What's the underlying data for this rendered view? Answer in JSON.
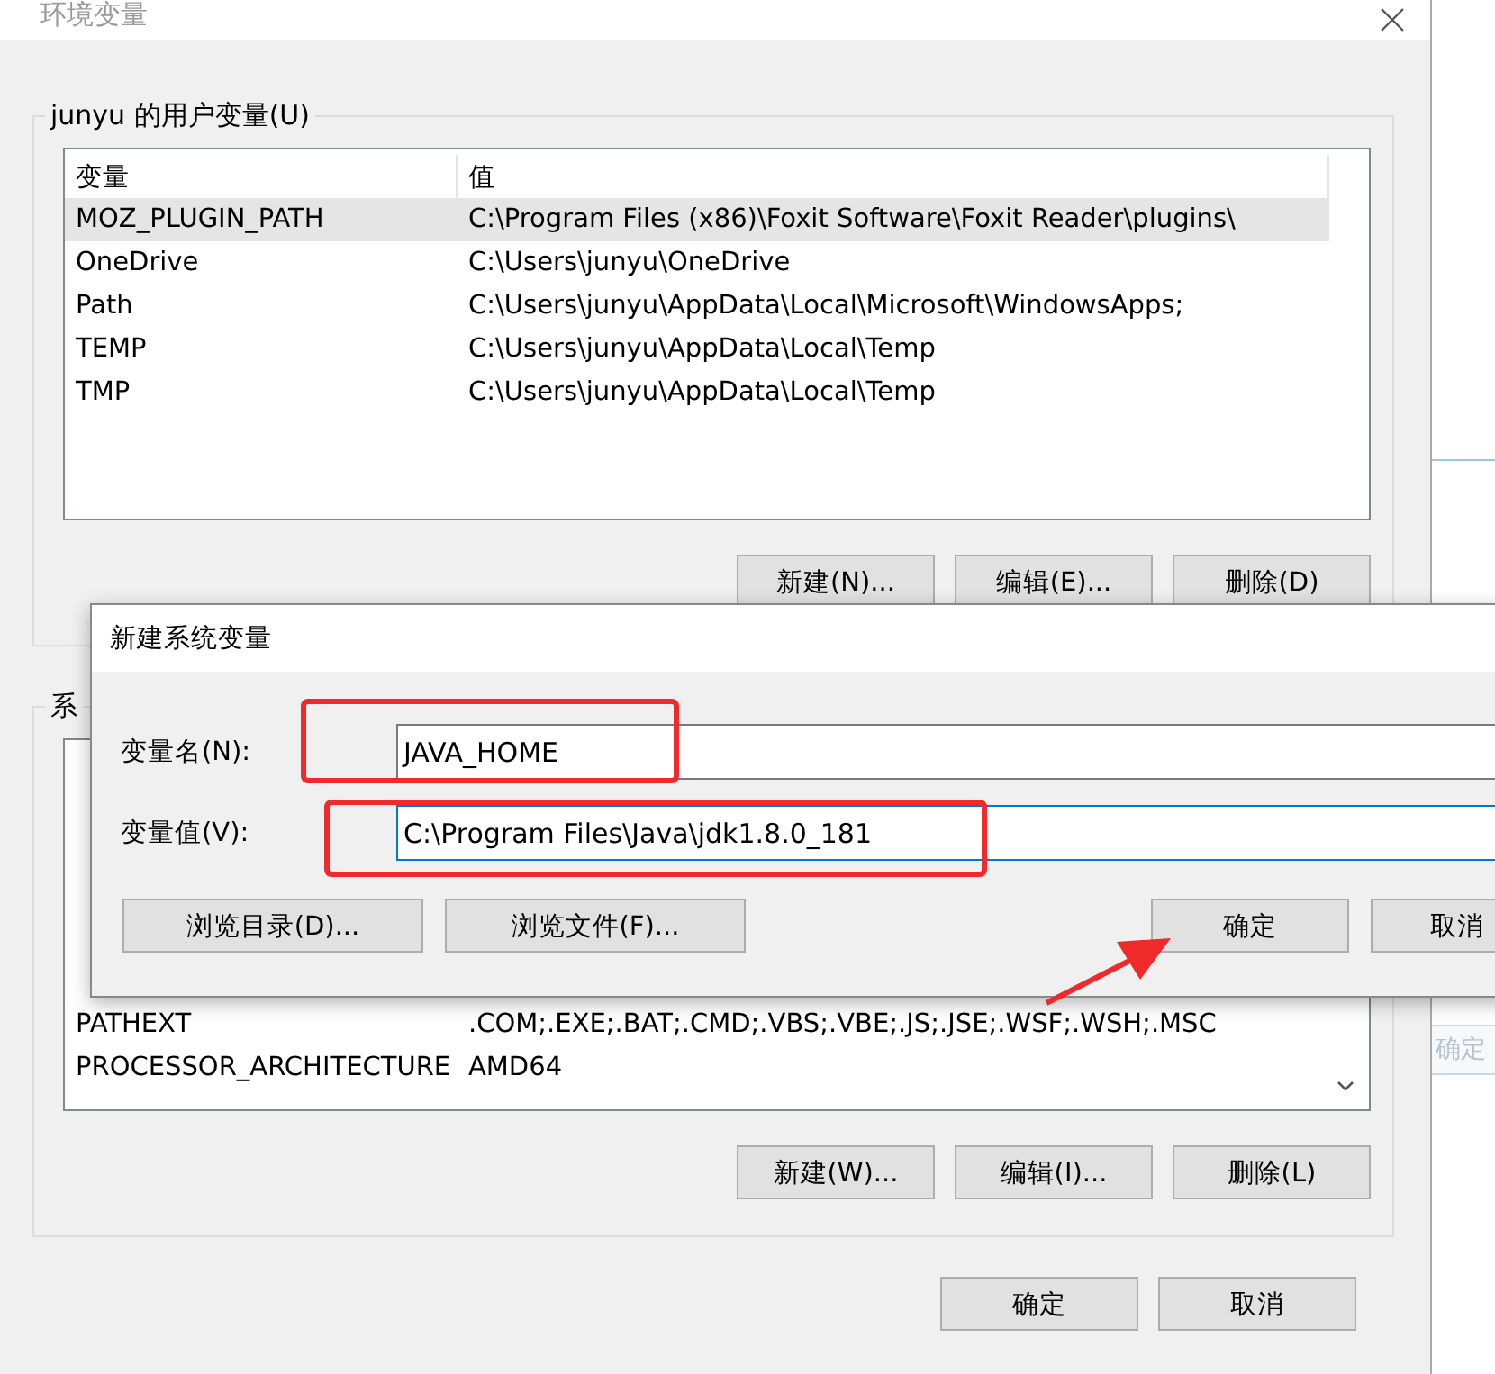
{
  "window": {
    "title": "环境变量",
    "user_group": {
      "label": "junyu 的用户变量(U)",
      "columns": [
        "变量",
        "值"
      ],
      "rows": [
        {
          "name": "MOZ_PLUGIN_PATH",
          "value": "C:\\Program Files (x86)\\Foxit Software\\Foxit Reader\\plugins\\",
          "selected": true
        },
        {
          "name": "OneDrive",
          "value": "C:\\Users\\junyu\\OneDrive",
          "selected": false
        },
        {
          "name": "Path",
          "value": "C:\\Users\\junyu\\AppData\\Local\\Microsoft\\WindowsApps;",
          "selected": false
        },
        {
          "name": "TEMP",
          "value": "C:\\Users\\junyu\\AppData\\Local\\Temp",
          "selected": false
        },
        {
          "name": "TMP",
          "value": "C:\\Users\\junyu\\AppData\\Local\\Temp",
          "selected": false
        }
      ],
      "buttons": [
        "新建(N)...",
        "编辑(E)...",
        "删除(D)"
      ]
    },
    "system_group": {
      "label": "系",
      "rows": [
        {
          "name": "PATHEXT",
          "value": ".COM;.EXE;.BAT;.CMD;.VBS;.VBE;.JS;.JSE;.WSF;.WSH;.MSC"
        },
        {
          "name": "PROCESSOR_ARCHITECTURE",
          "value": "AMD64"
        }
      ],
      "buttons": [
        "新建(W)...",
        "编辑(I)...",
        "删除(L)"
      ]
    },
    "buttons": [
      "确定",
      "取消"
    ]
  },
  "dialog": {
    "title": "新建系统变量",
    "fields": [
      {
        "label": "变量名(N):",
        "value": "JAVA_HOME",
        "focused": false
      },
      {
        "label": "变量值(V):",
        "value": "C:\\Program Files\\Java\\jdk1.8.0_181",
        "focused": true
      }
    ],
    "left_buttons": [
      "浏览目录(D)...",
      "浏览文件(F)..."
    ],
    "right_buttons": [
      "确定",
      "取消"
    ]
  },
  "background_window": {
    "button": "确定"
  }
}
